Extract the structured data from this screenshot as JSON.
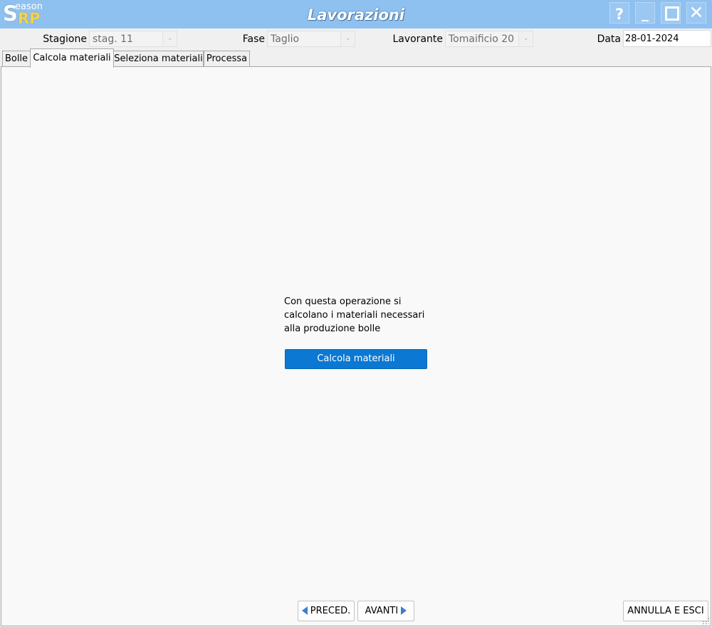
{
  "window": {
    "title": "Lavorazioni",
    "logo": {
      "small": "eason",
      "big": "S",
      "rp": "RP"
    },
    "controls": {
      "help": "?",
      "minimize": "_",
      "close": "✕"
    }
  },
  "filters": {
    "stagione": {
      "label": "Stagione",
      "value": "stag. 11"
    },
    "fase": {
      "label": "Fase",
      "value": "Taglio"
    },
    "lavorante": {
      "label": "Lavorante",
      "value": "Tomaificio 20"
    },
    "data": {
      "label": "Data",
      "value": "28-01-2024"
    }
  },
  "tabs": [
    {
      "label": "Bolle",
      "active": false
    },
    {
      "label": "Calcola materiali",
      "active": true
    },
    {
      "label": "Seleziona materiali",
      "active": false
    },
    {
      "label": "Processa",
      "active": false
    }
  ],
  "main": {
    "description": "Con questa operazione si calcolano i materiali necessari alla produzione bolle",
    "action_label": "Calcola materiali"
  },
  "footer": {
    "prev_label": "PRECED.",
    "next_label": "AVANTI",
    "cancel_label": "ANNULLA E ESCI"
  },
  "colors": {
    "titlebar": "#8fc1f0",
    "accent": "#0b78d3",
    "nav_arrow": "#3a7fd1",
    "logo_gold": "#f4d34b"
  }
}
